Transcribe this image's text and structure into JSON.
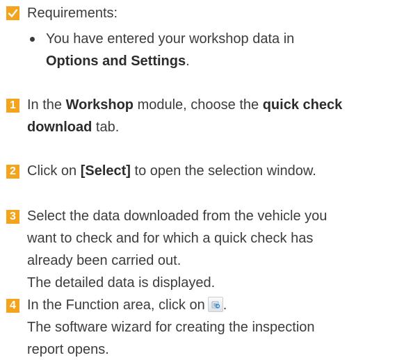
{
  "requirements": {
    "icon": "check-icon",
    "heading": "Requirements:",
    "bullet": {
      "line1": "You have entered your workshop data in",
      "line2_bold": "Options and Settings",
      "line2_tail": "."
    }
  },
  "steps": [
    {
      "number": "1",
      "line1_pre": "In the ",
      "line1_bold1": "Workshop",
      "line1_mid": " module, choose the ",
      "line1_bold2": "quick check",
      "line2_bold": "download",
      "line2_tail": " tab."
    },
    {
      "number": "2",
      "pre": "Click on ",
      "bold": "[Select]",
      "tail": " to open the selection window."
    },
    {
      "number": "3",
      "lines": [
        "Select the data downloaded from the vehicle you",
        "want to check and for which a quick check has",
        "already been carried out.",
        "The detailed data is displayed."
      ]
    },
    {
      "number": "4",
      "line1": "In the Function area, click on",
      "line1_tail": ".",
      "icon": "function-report-icon",
      "lines": [
        "The software wizard for creating the inspection",
        "report opens."
      ]
    }
  ],
  "colors": {
    "badge": "#f4a31c",
    "text": "#3c3c3c"
  }
}
